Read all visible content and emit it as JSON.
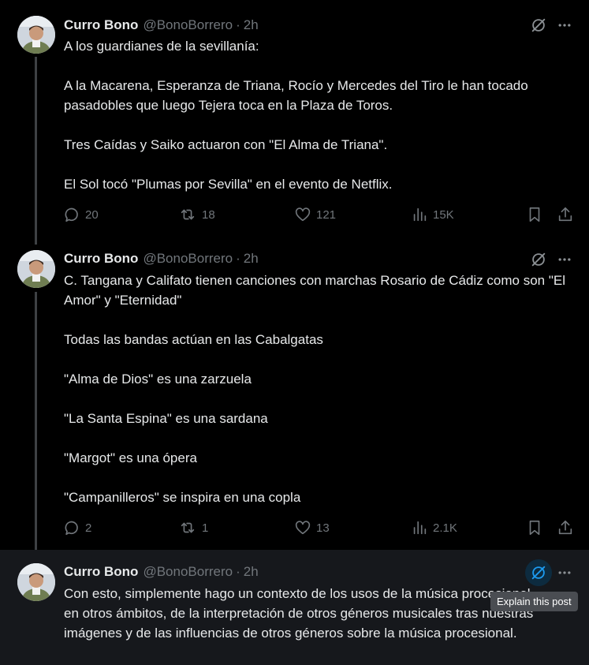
{
  "posts": [
    {
      "author": "Curro Bono",
      "handle": "@BonoBorrero",
      "separator": "·",
      "time": "2h",
      "paragraphs": [
        "A los guardianes de la sevillanía:",
        "",
        "A la Macarena, Esperanza de Triana, Rocío y Mercedes del Tiro le han tocado pasadobles que luego Tejera toca en la Plaza de Toros.",
        "",
        "Tres Caídas y Saiko actuaron con \"El Alma de Triana\".",
        "",
        "El Sol tocó \"Plumas por Sevilla\" en el evento de Netflix."
      ],
      "stats": {
        "replies": "20",
        "reposts": "18",
        "likes": "121",
        "views": "15K"
      }
    },
    {
      "author": "Curro Bono",
      "handle": "@BonoBorrero",
      "separator": "·",
      "time": "2h",
      "paragraphs": [
        "C. Tangana y Califato tienen canciones con marchas Rosario de Cádiz como son \"El Amor\" y \"Eternidad\"",
        "",
        "Todas las bandas actúan en las Cabalgatas",
        "",
        "\"Alma de Dios\" es una zarzuela",
        "",
        "\"La Santa Espina\" es una sardana",
        "",
        "\"Margot\" es una ópera",
        "",
        "\"Campanilleros\" se inspira en una copla"
      ],
      "stats": {
        "replies": "2",
        "reposts": "1",
        "likes": "13",
        "views": "2.1K"
      }
    },
    {
      "author": "Curro Bono",
      "handle": "@BonoBorrero",
      "separator": "·",
      "time": "2h",
      "paragraphs": [
        "Con esto, simplemente hago un contexto de los usos de la música procesional en otros ámbitos, de la interpretación de otros géneros musicales tras nuestras imágenes y de las influencias de otros géneros sobre la música procesional."
      ]
    }
  ],
  "tooltip": {
    "label": "Explain this post"
  },
  "icons": {
    "grok": "grok-explain-icon",
    "more": "more-options-icon",
    "reply": "reply-icon",
    "repost": "repost-icon",
    "like": "like-icon",
    "views": "views-icon",
    "bookmark": "bookmark-icon",
    "share": "share-icon"
  },
  "colors": {
    "background": "#000000",
    "text": "#e7e9ea",
    "muted": "#71767b",
    "accent": "#1d9bf0",
    "highlight_bg": "#16181c"
  }
}
